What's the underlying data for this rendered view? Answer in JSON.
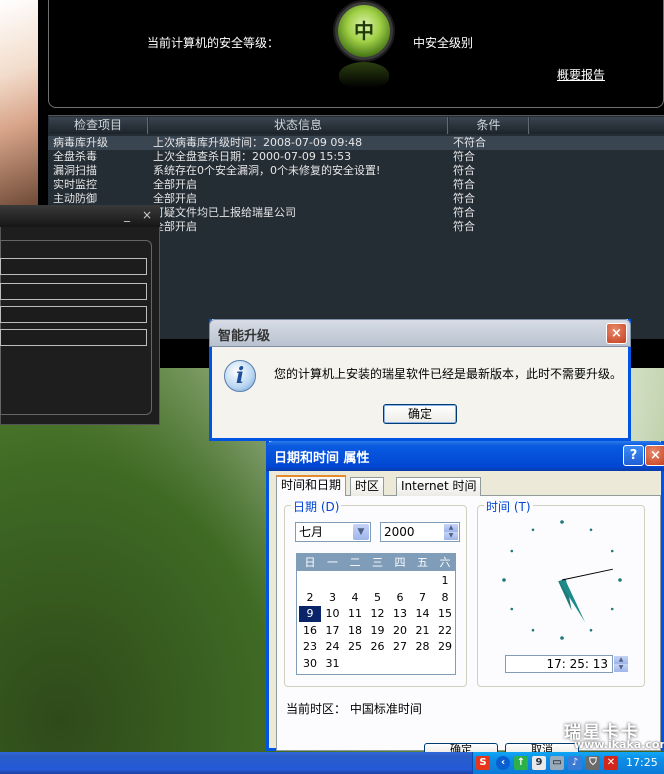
{
  "scanner": {
    "security_label": "当前计算机的安全等级：",
    "level_badge": "中",
    "level_text": "中安全级别",
    "report_link": "概要报告",
    "columns": [
      "检查项目",
      "状态信息",
      "条件"
    ],
    "rows": [
      {
        "item": "病毒库升级",
        "status": "上次病毒库升级时间：2008-07-09 09:48",
        "cond": "不符合"
      },
      {
        "item": "全盘杀毒",
        "status": "上次全盘查杀日期：2000-07-09 15:53",
        "cond": "符合"
      },
      {
        "item": "漏洞扫描",
        "status": "系统存在0个安全漏洞，0个未修复的安全设置!",
        "cond": "符合"
      },
      {
        "item": "实时监控",
        "status": "全部开启",
        "cond": "符合"
      },
      {
        "item": "主动防御",
        "status": "全部开启",
        "cond": "符合"
      },
      {
        "item": "",
        "status": "可疑文件均已上报给瑞星公司",
        "cond": "符合"
      },
      {
        "item": "",
        "status": "全部开启",
        "cond": "符合"
      }
    ]
  },
  "back_window": {
    "min": "_",
    "close": "×"
  },
  "update_dialog": {
    "title": "智能升级",
    "message": "您的计算机上安装的瑞星软件已经是最新版本，此时不需要升级。",
    "ok": "确定",
    "close": "×",
    "icon": "info-icon"
  },
  "datetime": {
    "title": "日期和时间 属性",
    "help": "?",
    "close": "×",
    "tabs": [
      "时间和日期",
      "时区",
      "Internet 时间"
    ],
    "date_group": "日期 (D)",
    "time_group": "时间 (T)",
    "month": "七月",
    "year": "2000",
    "weekdays": [
      "日",
      "一",
      "二",
      "三",
      "四",
      "五",
      "六"
    ],
    "days": [
      [
        "",
        "",
        "",
        "",
        "",
        "",
        "1"
      ],
      [
        "2",
        "3",
        "4",
        "5",
        "6",
        "7",
        "8"
      ],
      [
        "9",
        "10",
        "11",
        "12",
        "13",
        "14",
        "15"
      ],
      [
        "16",
        "17",
        "18",
        "19",
        "20",
        "21",
        "22"
      ],
      [
        "23",
        "24",
        "25",
        "26",
        "27",
        "28",
        "29"
      ],
      [
        "30",
        "31",
        "",
        "",
        "",
        "",
        ""
      ]
    ],
    "selected_day": "9",
    "time": "17: 25: 13",
    "clock": {
      "hour": 17,
      "minute": 25,
      "second": 13
    },
    "timezone_label": "当前时区： 中国标准时间",
    "buttons": [
      "确定",
      "取消"
    ]
  },
  "taskbar": {
    "clock": "17:25",
    "tray_icons": [
      "rising-s-icon",
      "back-icon",
      "network-icon",
      "app-icon",
      "monitor-icon",
      "volume-icon",
      "security-icon"
    ],
    "watermark": "瑞星卡卡",
    "watermark_url": "www.ikaka.com"
  }
}
